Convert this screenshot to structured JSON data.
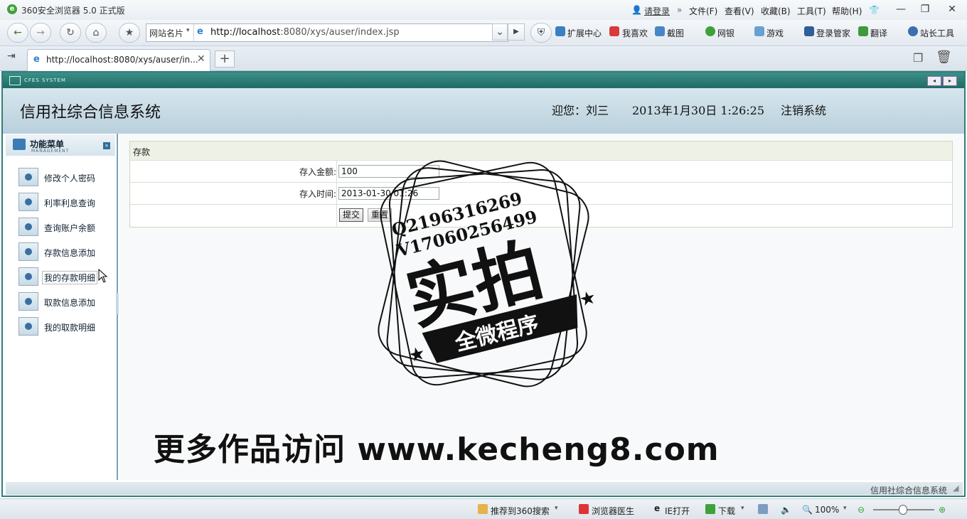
{
  "browser": {
    "title": "360安全浏览器 5.0 正式版",
    "login": "请登录",
    "menu": [
      "文件(F)",
      "查看(V)",
      "收藏(B)",
      "工具(T)",
      "帮助(H)"
    ],
    "winbtns": [
      "—",
      "❐",
      "✕"
    ],
    "site_label": "网站名片",
    "url_host": "http://localhost",
    "url_rest": ":8080/xys/auser/index.jsp",
    "tools": [
      "扩展中心",
      "我喜欢",
      "截图",
      "网银",
      "游戏",
      "登录管家",
      "翻译",
      "站长工具"
    ],
    "tab_title": "http://localhost:8080/xys/auser/in...",
    "newtab": "+",
    "tab_close": "✕"
  },
  "app": {
    "strip_text": "CFES SYSTEM",
    "system_name": "信用社综合信息系统",
    "welcome": "迎您：刘三",
    "datetime": "2013年1月30日  1:26:25",
    "logout": "注销系统",
    "sidebar": {
      "title": "功能菜单",
      "subtitle": "MANAGEMENT",
      "items": [
        "修改个人密码",
        "利率利息查询",
        "查询账户余额",
        "存款信息添加",
        "我的存款明细",
        "取款信息添加",
        "我的取款明细"
      ]
    },
    "form": {
      "title": "存款",
      "amount_label": "存入金额:",
      "amount_value": "100",
      "time_label": "存入时间:",
      "time_value": "2013-01-30 01:26",
      "submit": "提交",
      "reset": "重置"
    },
    "footer": "信用社综合信息系统"
  },
  "statusbar": {
    "items": [
      "推荐到360搜索",
      "浏览器医生",
      "IE打开",
      "下载"
    ],
    "zoom": "100%"
  },
  "watermark": {
    "line1": "Q2196316269",
    "line2": "V17060256499",
    "big": "实拍",
    "ribbon": "全微程序",
    "bottom": "更多作品访问 www.kecheng8.com"
  }
}
